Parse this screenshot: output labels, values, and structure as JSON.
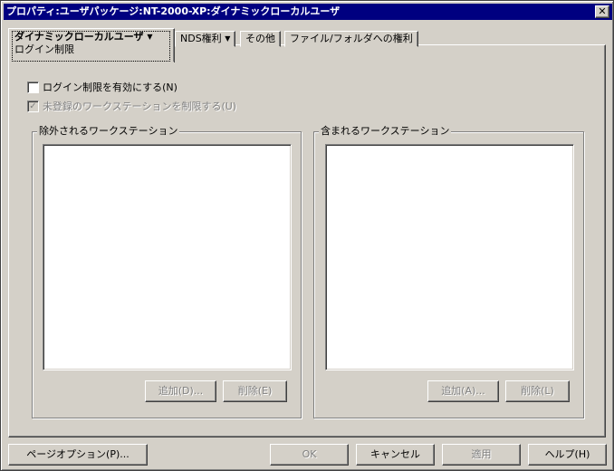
{
  "window": {
    "title": "プロパティ:ユーザパッケージ:NT-2000-XP:ダイナミックローカルユーザ",
    "close_label": "✕"
  },
  "tabs": {
    "active": {
      "label": "ダイナミックローカルユーザ",
      "sublabel": "ログイン制限"
    },
    "nds": {
      "label": "NDS権利"
    },
    "other": {
      "label": "その他"
    },
    "filefolder": {
      "label": "ファイル/フォルダへの権利"
    }
  },
  "checks": {
    "enable": {
      "label": "ログイン制限を有効にする(N)",
      "checked": false
    },
    "limit_unregistered": {
      "label": "未登録のワークステーションを制限する(U)",
      "checked": true,
      "disabled": true
    }
  },
  "excluded": {
    "title": "除外されるワークステーション",
    "add": "追加(D)...",
    "remove": "削除(E)"
  },
  "included": {
    "title": "含まれるワークステーション",
    "add": "追加(A)...",
    "remove": "削除(L)"
  },
  "footer": {
    "page_options": "ページオプション(P)...",
    "ok": "OK",
    "cancel": "キャンセル",
    "apply": "適用",
    "help": "ヘルプ(H)"
  },
  "icons": {
    "dropdown": "▼",
    "checkmark": "✓"
  }
}
